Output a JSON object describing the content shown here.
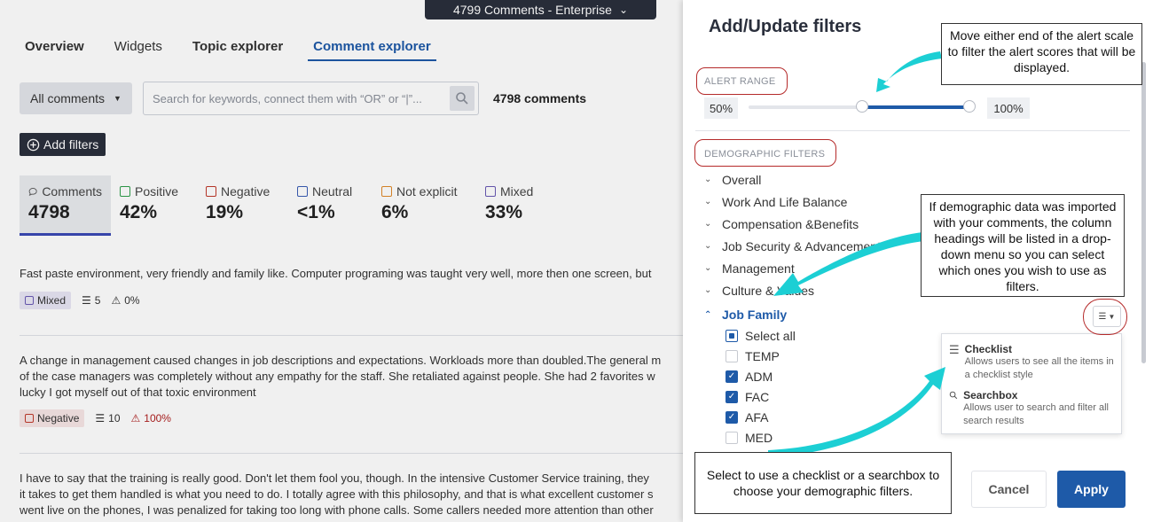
{
  "header": {
    "comments_pill": "4799 Comments - Enterprise"
  },
  "tabs": [
    {
      "label": "Overview"
    },
    {
      "label": "Widgets"
    },
    {
      "label": "Topic explorer"
    },
    {
      "label": "Comment explorer"
    }
  ],
  "toolbar": {
    "select_value": "All comments",
    "search_placeholder": "Search for keywords, connect them with “OR” or “|”...",
    "count": "4798 comments",
    "add_filters": "Add filters"
  },
  "stats": [
    {
      "label": "Comments",
      "value": "4798"
    },
    {
      "label": "Positive",
      "value": "42%",
      "color": "#2e9e4a"
    },
    {
      "label": "Negative",
      "value": "19%",
      "color": "#c0392b"
    },
    {
      "label": "Neutral",
      "value": "<1%",
      "color": "#3a5db5"
    },
    {
      "label": "Not explicit",
      "value": "6%",
      "color": "#e08a2a"
    },
    {
      "label": "Mixed",
      "value": "33%",
      "color": "#6a5ab5"
    }
  ],
  "comments": [
    {
      "lines": [
        "Fast paste environment, very friendly and family like. Computer programing was taught very well, more then one screen, but"
      ],
      "sentiment": "Mixed",
      "people": "5",
      "alert": "0%"
    },
    {
      "lines": [
        "A change in management caused changes in job descriptions and expectations. Workloads more than doubled.The general m",
        "of the case managers was completely without any empathy for the staff. She retaliated against people. She had 2 favorites w",
        "lucky I got myself out of that toxic environment"
      ],
      "sentiment": "Negative",
      "people": "10",
      "alert": "100%"
    },
    {
      "lines": [
        "I have to say that the training is really good. Don't let them fool you, though. In the intensive Customer Service training, they",
        "it takes to get them handled is what you need to do. I totally agree with this philosophy, and that is what excellent customer s",
        "went live on the phones, I was penalized for taking too long with phone calls. Some callers needed more attention than other"
      ]
    }
  ],
  "panel": {
    "title": "Add/Update filters",
    "alert_range_label": "ALERT RANGE",
    "range_min": "50%",
    "range_max": "100%",
    "range_low_fraction": 0.5,
    "range_high_fraction": 1.0,
    "demographic_label": "DEMOGRAPHIC FILTERS",
    "demographics": [
      {
        "label": "Overall"
      },
      {
        "label": "Work And Life Balance"
      },
      {
        "label": "Compensation &Benefits"
      },
      {
        "label": "Job Security & Advancement"
      },
      {
        "label": "Management"
      },
      {
        "label": "Culture & Values"
      }
    ],
    "active_group": "Job Family",
    "checks": [
      {
        "label": "Select all",
        "state": "partial"
      },
      {
        "label": "TEMP",
        "state": "off"
      },
      {
        "label": "ADM",
        "state": "on"
      },
      {
        "label": "FAC",
        "state": "on"
      },
      {
        "label": "AFA",
        "state": "on"
      },
      {
        "label": "MED",
        "state": "off"
      }
    ],
    "dropdown": [
      {
        "title": "Checklist",
        "desc": "Allows users to see all the items in a checklist style"
      },
      {
        "title": "Searchbox",
        "desc": "Allows user to search and filter all search results"
      }
    ],
    "cancel": "Cancel",
    "apply": "Apply"
  },
  "annotations": {
    "alert_callout": "Move either end of the alert scale to filter the alert scores that will be displayed.",
    "demographic_callout": "If demographic data was imported with your comments, the column headings will be listed in a drop-down menu so you can select which ones you wish to use as filters.",
    "checklist_callout": "Select to use a checklist or a searchbox to choose your demographic filters.",
    "arrow_color": "#1ccfd4"
  }
}
